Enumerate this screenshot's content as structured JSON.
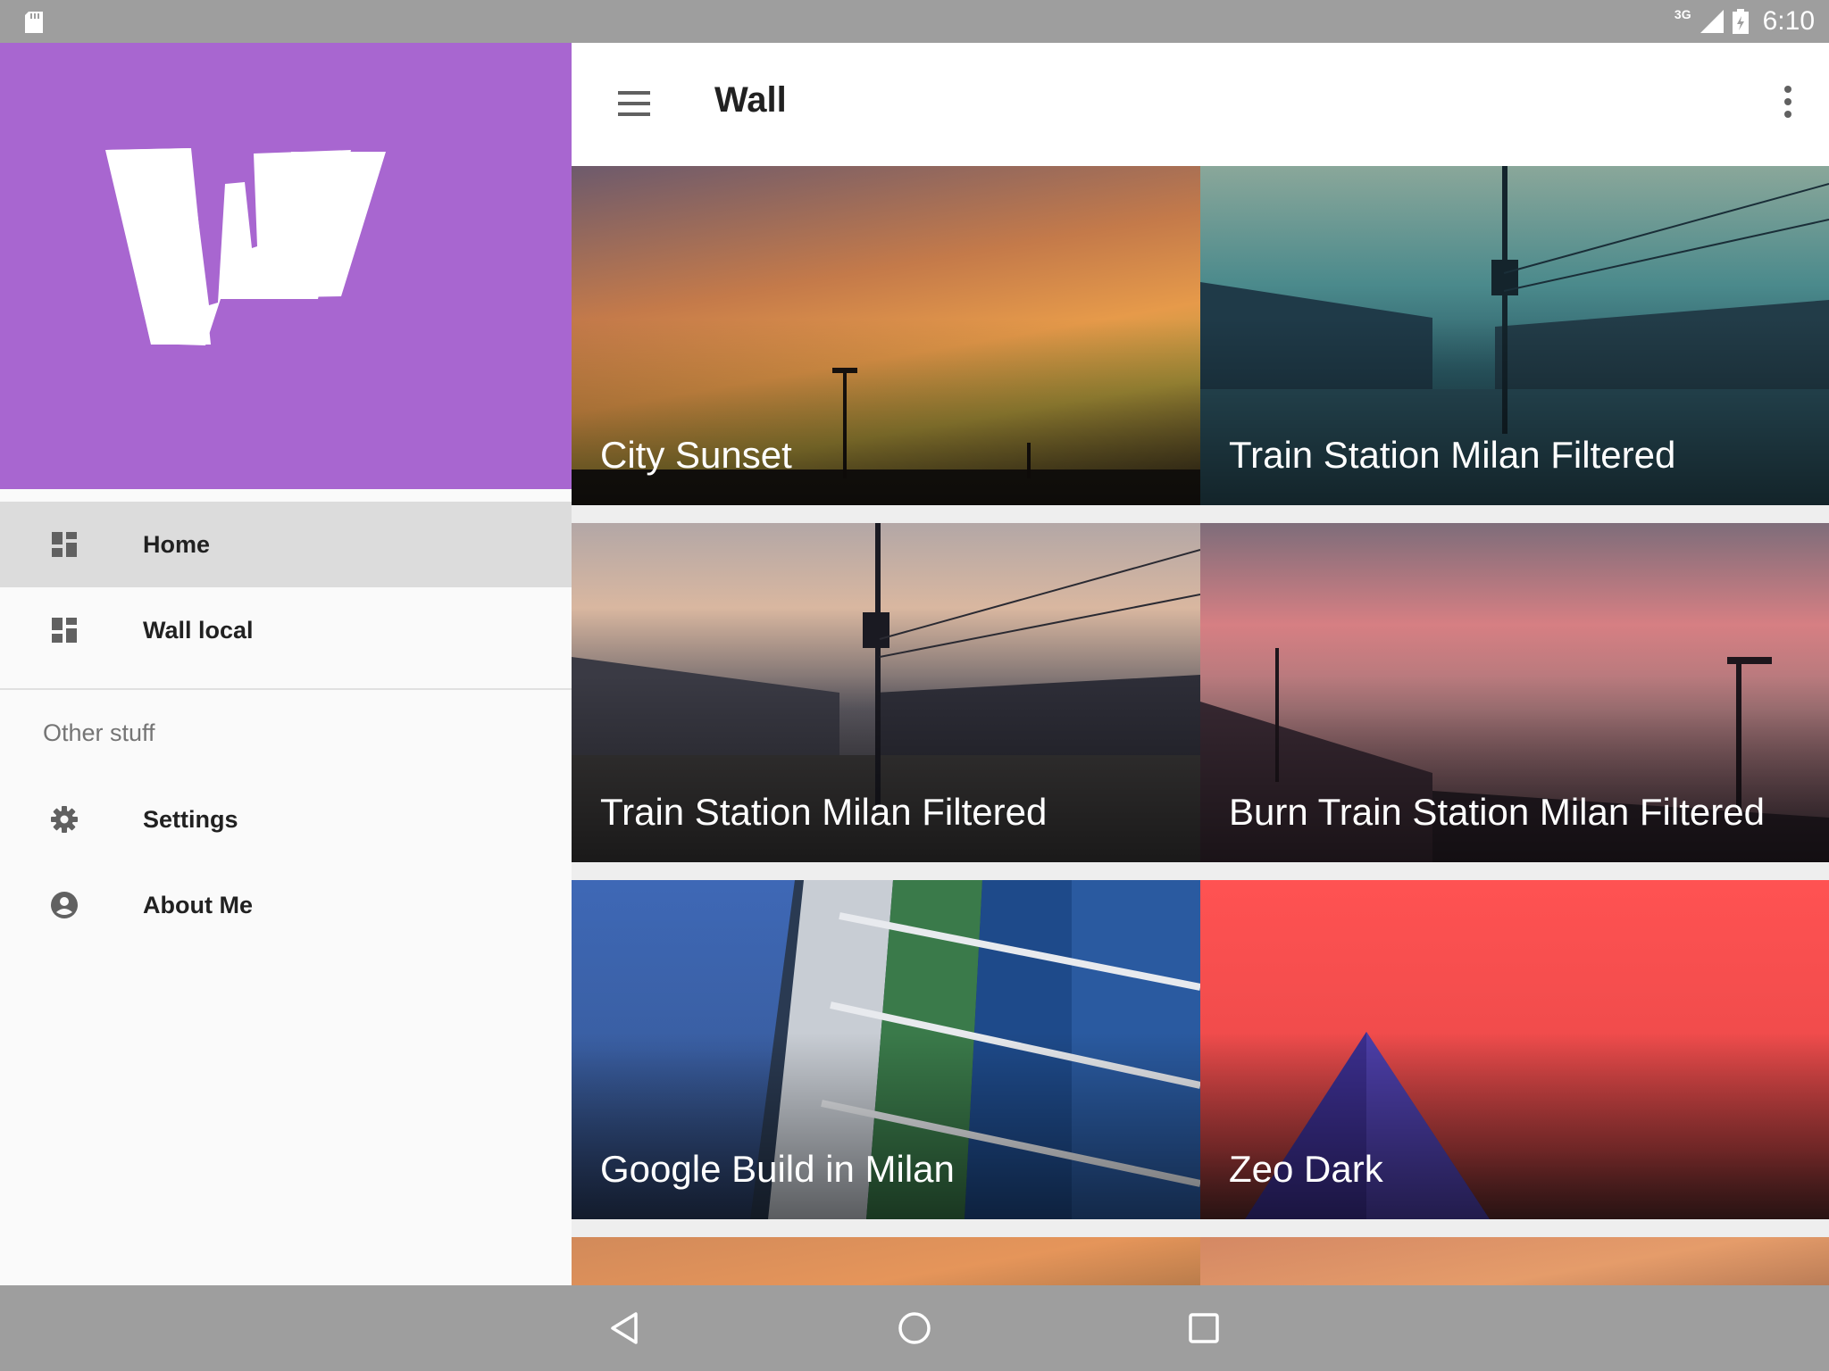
{
  "status_bar": {
    "network_type": "3G",
    "time": "6:10",
    "icons": [
      "sd-card-icon",
      "signal-icon",
      "battery-icon"
    ]
  },
  "drawer": {
    "header_color": "#a866d0",
    "logo_letter": "W",
    "primary_items": [
      {
        "label": "Home",
        "icon": "dashboard-icon",
        "active": true
      },
      {
        "label": "Wall local",
        "icon": "dashboard-icon",
        "active": false
      }
    ],
    "section_title": "Other stuff",
    "secondary_items": [
      {
        "label": "Settings",
        "icon": "gear-icon"
      },
      {
        "label": "About Me",
        "icon": "account-circle-icon"
      }
    ]
  },
  "toolbar": {
    "title": "Wall",
    "menu_icon": "hamburger-menu-icon",
    "overflow_icon": "more-vert-icon"
  },
  "wallpapers": [
    {
      "title": "City Sunset"
    },
    {
      "title": "Train Station Milan Filtered"
    },
    {
      "title": "Train Station Milan Filtered"
    },
    {
      "title": "Burn Train Station Milan Filtered"
    },
    {
      "title": "Google Build in Milan"
    },
    {
      "title": "Zeo Dark"
    }
  ],
  "nav_bar": {
    "buttons": [
      "back-icon",
      "home-icon",
      "recents-icon"
    ]
  }
}
